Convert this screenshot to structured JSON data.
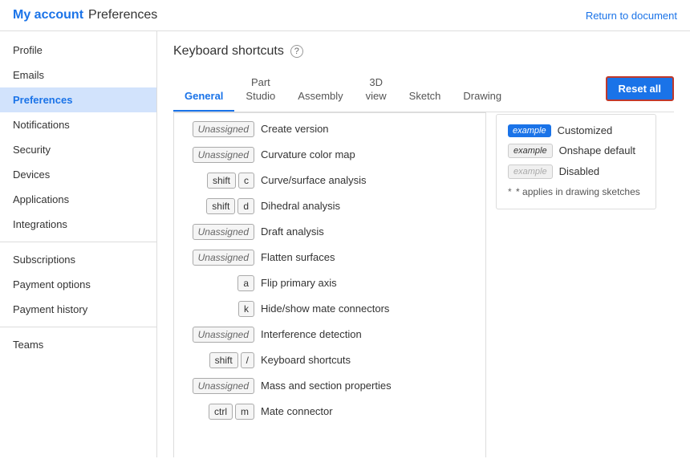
{
  "header": {
    "my_account_label": "My account",
    "preferences_label": "Preferences",
    "return_link_label": "Return to document"
  },
  "sidebar": {
    "items": [
      {
        "label": "Profile",
        "active": false,
        "id": "profile"
      },
      {
        "label": "Emails",
        "active": false,
        "id": "emails"
      },
      {
        "label": "Preferences",
        "active": true,
        "id": "preferences"
      },
      {
        "label": "Notifications",
        "active": false,
        "id": "notifications"
      },
      {
        "label": "Security",
        "active": false,
        "id": "security"
      },
      {
        "label": "Devices",
        "active": false,
        "id": "devices"
      },
      {
        "label": "Applications",
        "active": false,
        "id": "applications"
      },
      {
        "label": "Integrations",
        "active": false,
        "id": "integrations"
      },
      {
        "label": "Subscriptions",
        "active": false,
        "id": "subscriptions"
      },
      {
        "label": "Payment options",
        "active": false,
        "id": "payment-options"
      },
      {
        "label": "Payment history",
        "active": false,
        "id": "payment-history"
      },
      {
        "label": "Teams",
        "active": false,
        "id": "teams"
      }
    ]
  },
  "section": {
    "title": "Keyboard shortcuts",
    "help_icon": "?"
  },
  "tabs": [
    {
      "label": "General",
      "active": true
    },
    {
      "label": "Part\nStudio",
      "active": false
    },
    {
      "label": "Assembly",
      "active": false
    },
    {
      "label": "3D\nview",
      "active": false
    },
    {
      "label": "Sketch",
      "active": false
    },
    {
      "label": "Drawing",
      "active": false
    }
  ],
  "reset_all_button": "Reset all",
  "shortcuts": [
    {
      "keys": [
        {
          "type": "unassigned",
          "label": "Unassigned"
        }
      ],
      "label": "Create version"
    },
    {
      "keys": [
        {
          "type": "unassigned",
          "label": "Unassigned"
        }
      ],
      "label": "Curvature color map"
    },
    {
      "keys": [
        {
          "type": "key",
          "label": "shift"
        },
        {
          "type": "key",
          "label": "c"
        }
      ],
      "label": "Curve/surface analysis"
    },
    {
      "keys": [
        {
          "type": "key",
          "label": "shift"
        },
        {
          "type": "key",
          "label": "d"
        }
      ],
      "label": "Dihedral analysis"
    },
    {
      "keys": [
        {
          "type": "unassigned",
          "label": "Unassigned"
        }
      ],
      "label": "Draft analysis"
    },
    {
      "keys": [
        {
          "type": "unassigned",
          "label": "Unassigned"
        }
      ],
      "label": "Flatten surfaces"
    },
    {
      "keys": [
        {
          "type": "key",
          "label": "a"
        }
      ],
      "label": "Flip primary axis"
    },
    {
      "keys": [
        {
          "type": "key",
          "label": "k"
        }
      ],
      "label": "Hide/show mate connectors"
    },
    {
      "keys": [
        {
          "type": "unassigned",
          "label": "Unassigned"
        }
      ],
      "label": "Interference detection"
    },
    {
      "keys": [
        {
          "type": "key",
          "label": "shift"
        },
        {
          "type": "key",
          "label": "/"
        }
      ],
      "label": "Keyboard shortcuts"
    },
    {
      "keys": [
        {
          "type": "unassigned",
          "label": "Unassigned"
        }
      ],
      "label": "Mass and section properties"
    },
    {
      "keys": [
        {
          "type": "key",
          "label": "ctrl"
        },
        {
          "type": "key",
          "label": "m"
        }
      ],
      "label": "Mate connector"
    }
  ],
  "legend": {
    "items": [
      {
        "type": "customized",
        "example_label": "example",
        "description": "Customized"
      },
      {
        "type": "onshape",
        "example_label": "example",
        "description": "Onshape default"
      },
      {
        "type": "disabled",
        "example_label": "example",
        "description": "Disabled"
      }
    ],
    "note": "* applies in drawing sketches"
  }
}
